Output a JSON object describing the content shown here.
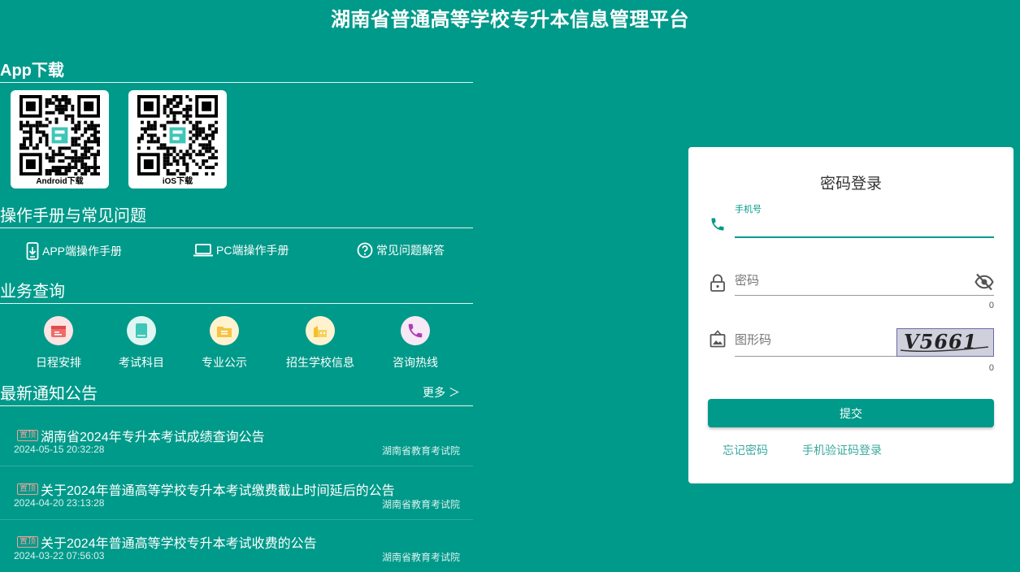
{
  "page_title": "湖南省普通高等学校专升本信息管理平台",
  "app_section": {
    "title": "App下载",
    "qrcodes": [
      {
        "label": "Android下载"
      },
      {
        "label": "iOS下载"
      }
    ]
  },
  "manual_section": {
    "title": "操作手册与常见问题",
    "links": [
      {
        "label": "APP端操作手册",
        "icon": "mobile-download-icon"
      },
      {
        "label": "PC端操作手册",
        "icon": "laptop-icon"
      },
      {
        "label": "常见问题解答",
        "icon": "question-circle-icon"
      }
    ]
  },
  "business_section": {
    "title": "业务查询",
    "items": [
      {
        "label": "日程安排",
        "icon": "calendar-icon",
        "bg": "#fde3e3",
        "color": "#ef6b6b"
      },
      {
        "label": "考试科目",
        "icon": "book-icon",
        "bg": "#dff6f3",
        "color": "#3fc6b8"
      },
      {
        "label": "专业公示",
        "icon": "folder-icon",
        "bg": "#fff2cf",
        "color": "#f6c343"
      },
      {
        "label": "招生学校信息",
        "icon": "school-icon",
        "bg": "#fff2cf",
        "color": "#f3c02a"
      },
      {
        "label": "咨询热线",
        "icon": "phone-icon",
        "bg": "#f6e8f5",
        "color": "#b03cb6"
      }
    ]
  },
  "notice_section": {
    "title": "最新通知公告",
    "more_label": "更多 ＞",
    "tag_label": "置顶",
    "items": [
      {
        "title": "湖南省2024年专升本考试成绩查询公告",
        "date": "2024-05-15 20:32:28",
        "source": "湖南省教育考试院"
      },
      {
        "title": "关于2024年普通高等学校专升本考试缴费截止时间延后的公告",
        "date": "2024-04-20 23:13:28",
        "source": "湖南省教育考试院"
      },
      {
        "title": "关于2024年普通高等学校专升本考试收费的公告",
        "date": "2024-03-22 07:56:03",
        "source": "湖南省教育考试院"
      }
    ]
  },
  "login": {
    "title": "密码登录",
    "phone_label": "手机号",
    "phone_value": "",
    "password_placeholder": "密码",
    "password_counter": "0",
    "captcha_placeholder": "图形码",
    "captcha_counter": "0",
    "captcha_text": "V5661",
    "submit_label": "提交",
    "forgot_label": "忘记密码",
    "sms_login_label": "手机验证码登录"
  },
  "colors": {
    "primary": "#009a8a",
    "tag": "#f2a29a"
  }
}
